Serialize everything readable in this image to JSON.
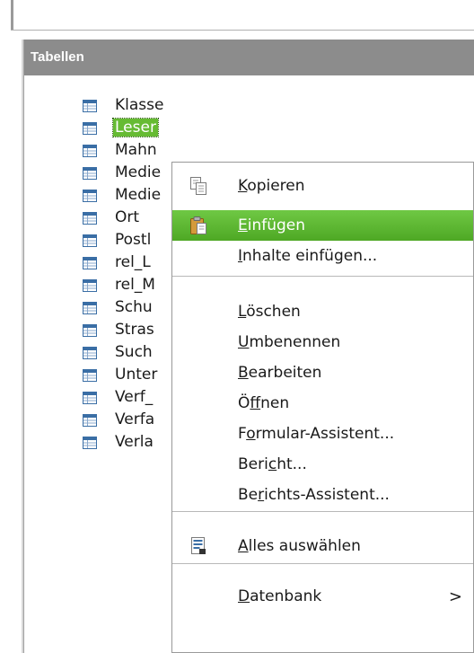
{
  "panel": {
    "title": "Tabellen"
  },
  "tables": [
    {
      "label": "Klasse"
    },
    {
      "label": "Leser"
    },
    {
      "label": "Mahn"
    },
    {
      "label": "Medie"
    },
    {
      "label": "Medie"
    },
    {
      "label": "Ort"
    },
    {
      "label": "Postl"
    },
    {
      "label": "rel_L"
    },
    {
      "label": "rel_M"
    },
    {
      "label": "Schu"
    },
    {
      "label": "Stras"
    },
    {
      "label": "Such"
    },
    {
      "label": "Unter"
    },
    {
      "label": "Verf_"
    },
    {
      "label": "Verfa"
    },
    {
      "label": "Verla"
    }
  ],
  "selected_table_index": 1,
  "context_menu": {
    "items": [
      {
        "pre": "",
        "mn": "K",
        "post": "opieren",
        "icon": "copy-icon"
      },
      {
        "pre": "",
        "mn": "E",
        "post": "infügen",
        "icon": "paste-icon",
        "highlighted": true
      },
      {
        "pre": "",
        "mn": "I",
        "post": "nhalte einfügen..."
      },
      {
        "pre": "",
        "mn": "L",
        "post": "öschen"
      },
      {
        "pre": "",
        "mn": "U",
        "post": "mbenennen"
      },
      {
        "pre": "",
        "mn": "B",
        "post": "earbeiten"
      },
      {
        "pre": "Ö",
        "mn": "f",
        "post": "fnen"
      },
      {
        "pre": "F",
        "mn": "o",
        "post": "rmular-Assistent..."
      },
      {
        "pre": "Beri",
        "mn": "c",
        "post": "ht..."
      },
      {
        "pre": "Be",
        "mn": "r",
        "post": "ichts-Assistent..."
      },
      {
        "pre": "",
        "mn": "A",
        "post": "lles auswählen",
        "icon": "select-all-icon"
      },
      {
        "pre": "",
        "mn": "D",
        "post": "atenbank",
        "submenu": true
      }
    ],
    "submenu_arrow": ">"
  },
  "colors": {
    "highlight": "#5cb832",
    "selection": "#66bb33",
    "panel_header": "#8c8c8c",
    "table_icon": "#3a6ea5"
  }
}
